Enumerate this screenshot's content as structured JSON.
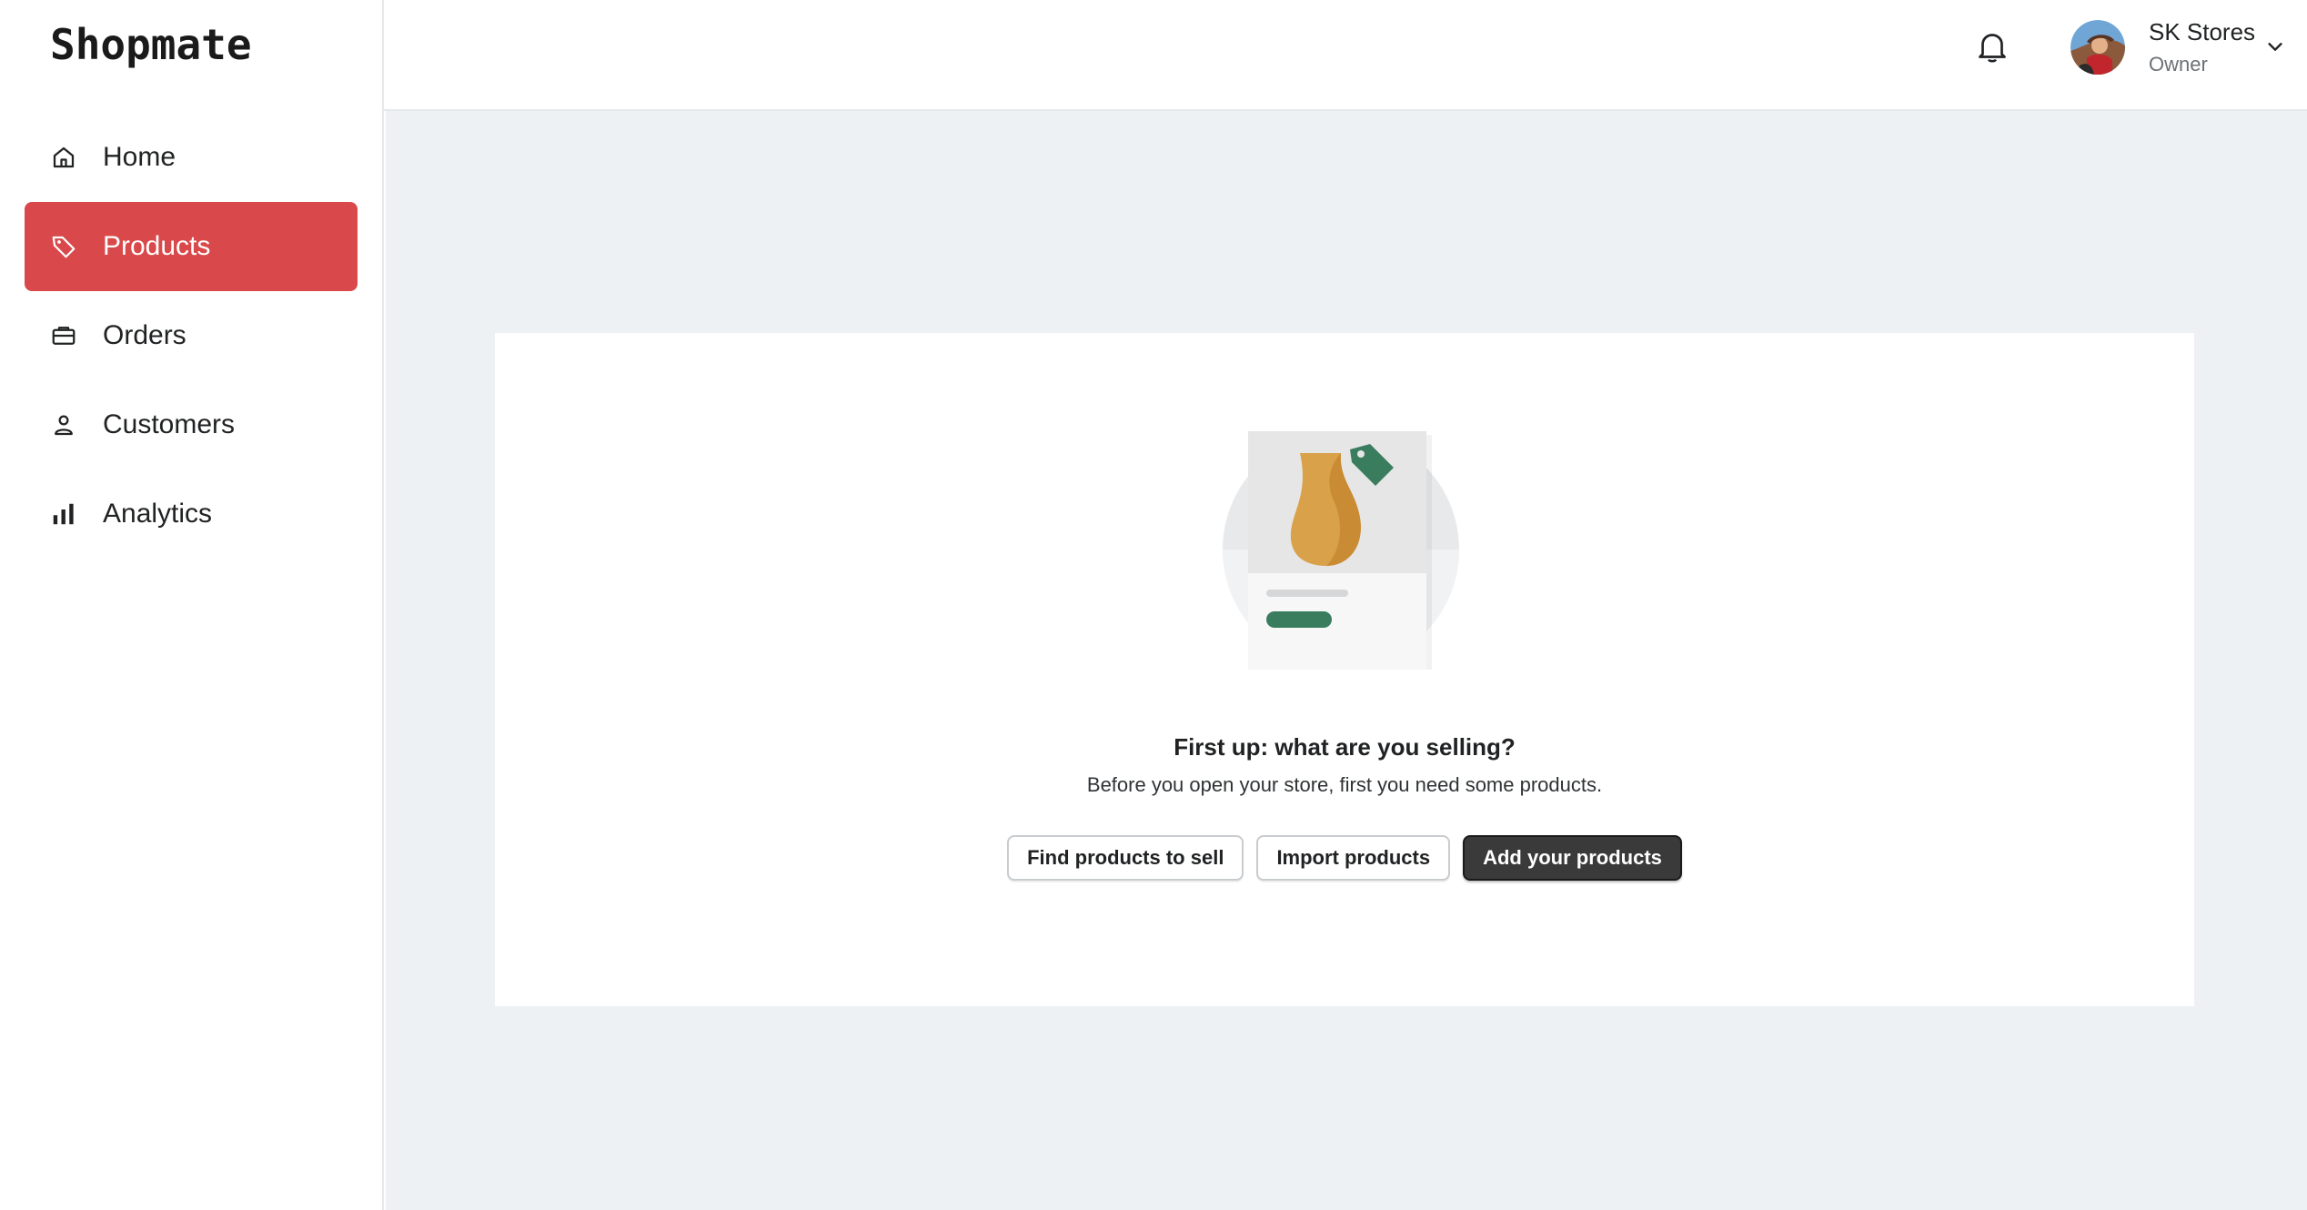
{
  "app": {
    "logo_text": "Shopmate"
  },
  "sidebar": {
    "items": [
      {
        "label": "Home",
        "icon": "home-icon",
        "active": false
      },
      {
        "label": "Products",
        "icon": "tag-icon",
        "active": true
      },
      {
        "label": "Orders",
        "icon": "briefcase-icon",
        "active": false
      },
      {
        "label": "Customers",
        "icon": "person-icon",
        "active": false
      },
      {
        "label": "Analytics",
        "icon": "bar-chart-icon",
        "active": false
      }
    ]
  },
  "topbar": {
    "notification_icon": "bell-icon",
    "user": {
      "name": "SK Stores",
      "role": "Owner"
    }
  },
  "empty_state": {
    "title": "First up: what are you selling?",
    "subtitle": "Before you open your store, first you need some products.",
    "buttons": {
      "find": "Find products to sell",
      "import": "Import products",
      "add": "Add your products"
    }
  },
  "colors": {
    "accent": "#d9484a",
    "primary_button": "#3a3a3a",
    "background": "#eef1f4",
    "illustration_green": "#3a7d5e",
    "illustration_gold": "#d9a24a"
  }
}
